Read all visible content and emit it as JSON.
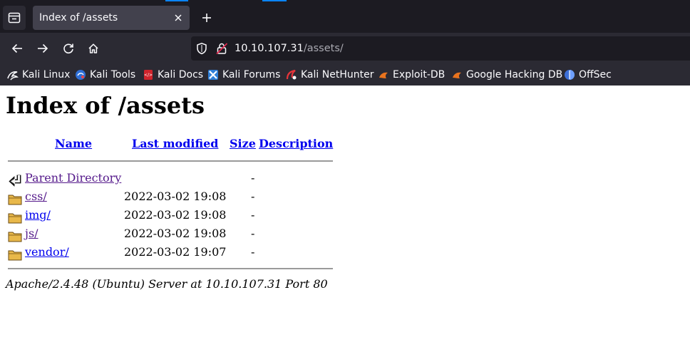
{
  "browser": {
    "tab": {
      "title": "Index of /assets"
    },
    "url": {
      "host": "10.10.107.31",
      "path": "/assets/"
    },
    "bookmarks": [
      {
        "label": "Kali Linux",
        "icon": "kali-dragon-icon"
      },
      {
        "label": "Kali Tools",
        "icon": "kali-tools-icon"
      },
      {
        "label": "Kali Docs",
        "icon": "kali-docs-icon"
      },
      {
        "label": "Kali Forums",
        "icon": "kali-forums-icon"
      },
      {
        "label": "Kali NetHunter",
        "icon": "nethunter-icon"
      },
      {
        "label": "Exploit-DB",
        "icon": "exploit-db-icon"
      },
      {
        "label": "Google Hacking DB",
        "icon": "ghdb-icon"
      },
      {
        "label": "OffSec",
        "icon": "offsec-icon"
      }
    ]
  },
  "page": {
    "title": "Index of /assets",
    "columns": {
      "name": "Name",
      "modified": "Last modified",
      "size": "Size",
      "description": "Description"
    },
    "rows": [
      {
        "icon": "back-arrow-icon",
        "name": "Parent Directory",
        "modified": "",
        "size": "-",
        "description": ""
      },
      {
        "icon": "folder-icon",
        "name": "css/",
        "modified": "2022-03-02 19:08",
        "size": "-",
        "description": ""
      },
      {
        "icon": "folder-icon",
        "name": "img/",
        "modified": "2022-03-02 19:08",
        "size": "-",
        "description": ""
      },
      {
        "icon": "folder-icon",
        "name": "js/",
        "modified": "2022-03-02 19:08",
        "size": "-",
        "description": ""
      },
      {
        "icon": "folder-icon",
        "name": "vendor/",
        "modified": "2022-03-02 19:07",
        "size": "-",
        "description": ""
      }
    ],
    "footer": "Apache/2.4.48 (Ubuntu) Server at 10.10.107.31 Port 80"
  },
  "colors": {
    "link": "#0000ee",
    "visited_link": "#551a8b",
    "chrome_dark": "#1c1b22",
    "toolbar": "#2b2a33",
    "accent": "#0a84ff"
  }
}
